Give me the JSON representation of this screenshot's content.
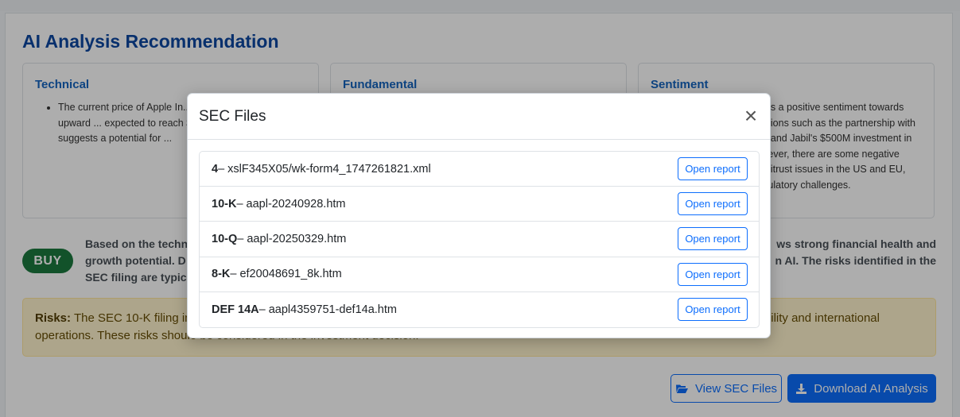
{
  "panel": {
    "title": "AI Analysis Recommendation",
    "cards": [
      {
        "title": "Technical",
        "text": "The current price of Apple In... forecast indicates an upward ... expected to reach $251.08 by ... This suggests a potential for ..."
      },
      {
        "title": "Fundamental",
        "text": ""
      },
      {
        "title": "Sentiment",
        "text": "...ts a positive sentiment towards ...tions such as the partnership with ... and Jabil's $500M investment in ...ever, there are some negative ...titrust issues in the US and EU, ...ulatory challenges."
      }
    ],
    "recommendation": "BUY",
    "summary_left": "Based on the techni",
    "summary_left_2": "growth potential. D",
    "summary_left_3": "SEC filing are typica",
    "summary_right": "ws strong financial health and",
    "summary_right_2": "n AI. The risks identified in the",
    "risks_label": "Risks:",
    "risks_text_1": "The SEC 10-K filing incl",
    "risks_text_2": "operations. These risks shoulo be considered in the investment decision.",
    "risks_text_right": "ility and international",
    "view_sec_label": "View SEC Files",
    "download_label": "Download AI Analysis"
  },
  "modal": {
    "title": "SEC Files",
    "close_symbol": "×",
    "open_label": "Open report",
    "files": [
      {
        "form": "4",
        "name": " – xslF345X05/wk-form4_1747261821.xml"
      },
      {
        "form": "10-K",
        "name": " – aapl-20240928.htm"
      },
      {
        "form": "10-Q",
        "name": " – aapl-20250329.htm"
      },
      {
        "form": "8-K",
        "name": " – ef20048691_8k.htm"
      },
      {
        "form": "DEF 14A",
        "name": " – aapl4359751-def14a.htm"
      }
    ]
  },
  "icons": {
    "folder": "folder-open-icon",
    "download": "download-icon",
    "close": "close-icon"
  },
  "colors": {
    "accent": "#0d6efd",
    "buy": "#1b7a3e",
    "title": "#0d47a1"
  }
}
